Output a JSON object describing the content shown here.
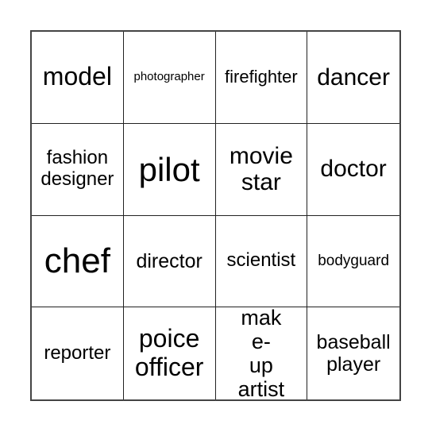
{
  "bingo": {
    "cells": [
      "model",
      "photographer",
      "firefighter",
      "dancer",
      "fashion designer",
      "pilot",
      "movie star",
      "doctor",
      "chef",
      "director",
      "scientist",
      "bodyguard",
      "reporter",
      "poice officer",
      "make- up artist",
      "baseball player"
    ]
  }
}
